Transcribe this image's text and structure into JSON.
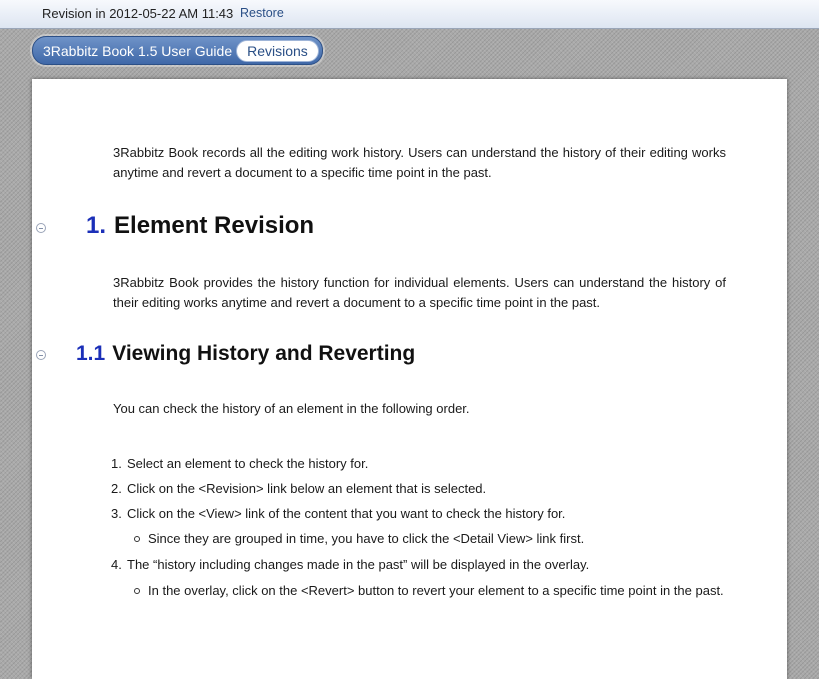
{
  "topbar": {
    "revision_label": "Revision in 2012-05-22 AM 11:43",
    "restore_label": "Restore"
  },
  "breadcrumb": {
    "book_title": "3Rabbitz Book 1.5 User Guide",
    "active_tab": "Revisions"
  },
  "document": {
    "intro": "3Rabbitz Book records all the editing work history. Users can understand the history of their editing works anytime and revert a document to a specific time point in the past.",
    "section1": {
      "number": "1.",
      "title": "Element Revision",
      "body": "3Rabbitz Book provides the history function for individual elements. Users can understand the history of their editing works anytime and revert a document to a specific time point in the past."
    },
    "section1_1": {
      "number": "1.1",
      "title": "Viewing History and Reverting",
      "body": "You can check the history of an element in the following order.",
      "steps": [
        {
          "marker": "1.",
          "text": "Select an element to check the history for."
        },
        {
          "marker": "2.",
          "text": "Click on the <Revision> link below an element that is selected."
        },
        {
          "marker": "3.",
          "text": "Click on the <View> link of the content that you want to check the history for."
        },
        {
          "marker": "4.",
          "text": "The “history including changes made in the past” will be displayed in the overlay."
        }
      ],
      "subpoints": [
        "Since they are grouped in time, you have to click the <Detail View> link first.",
        "In the overlay, click on the <Revert> button to revert your element to a specific time point in the past."
      ]
    }
  }
}
